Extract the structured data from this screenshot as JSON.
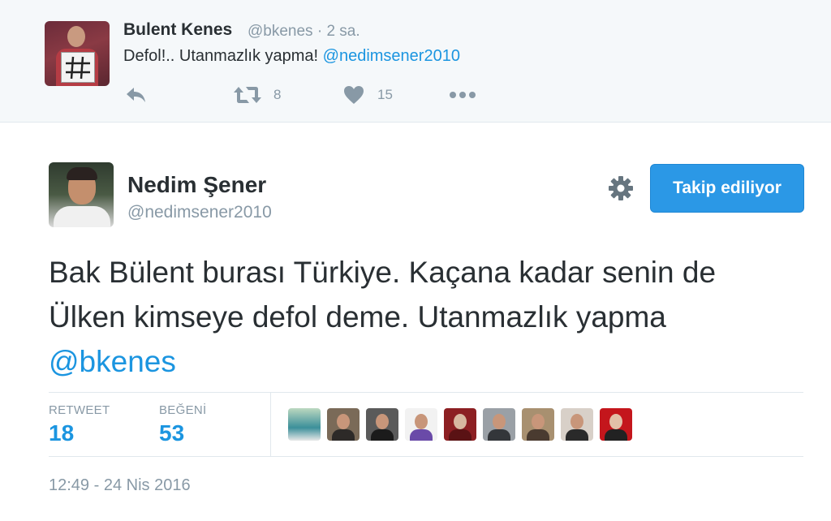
{
  "parent_tweet": {
    "name": "Bulent Kenes",
    "handle": "@bkenes",
    "time": "· 2 sa.",
    "text": "Defol!.. Utanmazlık yapma! ",
    "mention": "@nedimsener2010",
    "retweets": "8",
    "likes": "15",
    "icons": [
      "reply-icon",
      "retweet-icon",
      "heart-icon",
      "more-icon"
    ]
  },
  "main_tweet": {
    "name": "Nedim Şener",
    "handle": "@nedimsener2010",
    "follow_label": "Takip ediliyor",
    "text": "Bak Bülent burası Türkiye. Kaçana kadar senin de Ülken kimseye defol deme. Utanmazlık yapma ",
    "mention": "@bkenes",
    "retweet_label": "RETWEET",
    "retweet_count": "18",
    "like_label": "BEĞENİ",
    "like_count": "53",
    "timestamp": "12:49 - 24 Nis 2016"
  },
  "colors": {
    "accent": "#1b95e0",
    "button": "#2b98e6",
    "muted": "#8899a6",
    "text": "#292f33",
    "parent_bg": "#f5f8fa"
  }
}
